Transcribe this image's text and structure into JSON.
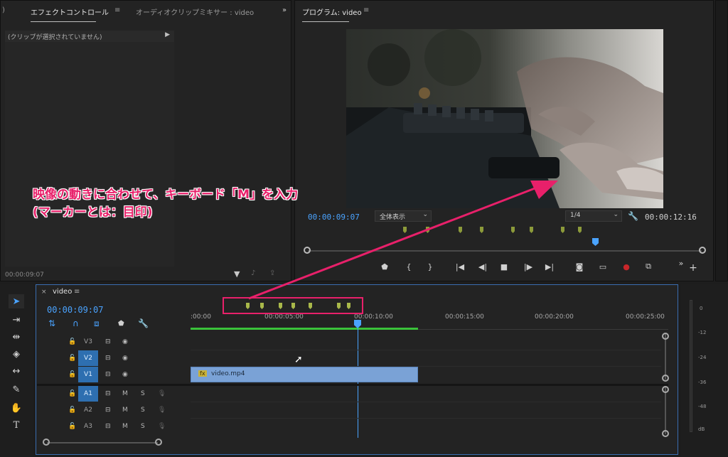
{
  "effect_panel": {
    "tab_effect_controls": "エフェクトコントロール",
    "tab_audio_mixer": "オーディオクリップミキサー : video",
    "no_clip": "(クリップが選択されていません)",
    "timecode": "00:00:09:07"
  },
  "program_monitor": {
    "title": "プログラム: video",
    "current_time": "00:00:09:07",
    "zoom": "全体表示",
    "resolution": "1/4",
    "duration": "00:00:12:16"
  },
  "timeline": {
    "sequence_name": "video",
    "timecode": "00:00:09:07",
    "ruler": [
      ":00:00",
      "00:00:05:00",
      "00:00:10:00",
      "00:00:15:00",
      "00:00:20:00",
      "00:00:25:00"
    ],
    "video_tracks": [
      {
        "label": "V3",
        "target": false
      },
      {
        "label": "V2",
        "target": true
      },
      {
        "label": "V1",
        "target": true
      }
    ],
    "audio_tracks": [
      {
        "label": "A1",
        "target": true,
        "m": "M",
        "s": "S"
      },
      {
        "label": "A2",
        "target": false,
        "m": "M",
        "s": "S"
      },
      {
        "label": "A3",
        "target": false,
        "m": "M",
        "s": "S"
      }
    ],
    "clip_name": "video.mp4",
    "clip_badge": "fx"
  },
  "audio_meter": {
    "scale": [
      "0",
      "-12",
      "-24",
      "-36",
      "-48",
      "dB"
    ]
  },
  "annotation": {
    "line1": "映像の動きに合わせて、キーボード「M」を入力",
    "line2": "(マーカーとは：目印)",
    "color": "#e8206a"
  },
  "colors": {
    "accent_blue": "#4aa3ff",
    "marker": "#8c9a3a",
    "clip": "#7aa2d6",
    "work_area": "#3ac23a"
  }
}
